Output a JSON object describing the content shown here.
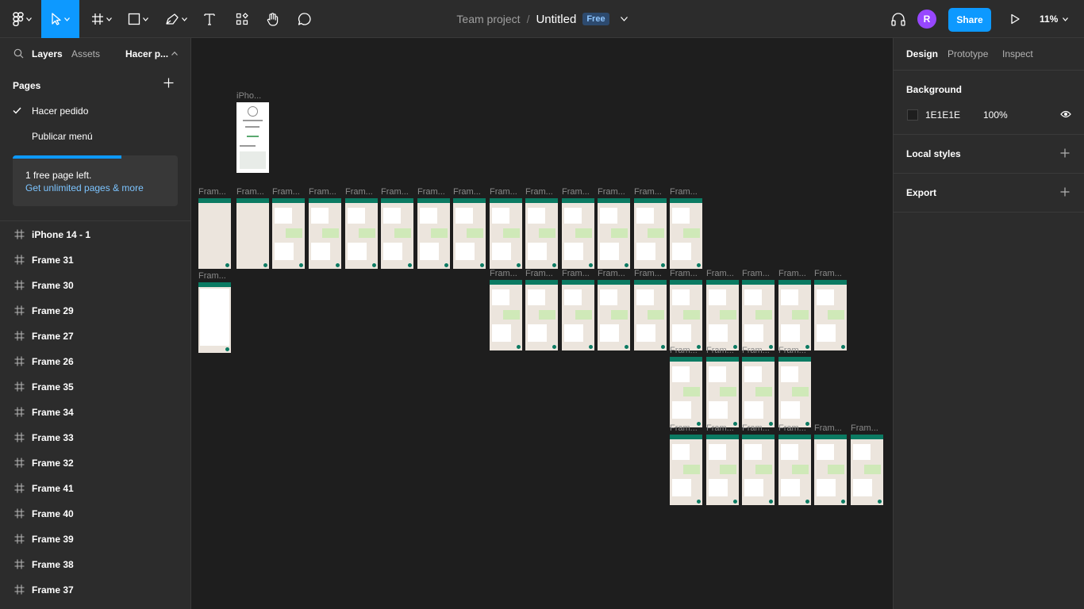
{
  "toolbar": {
    "tools": [
      "main-menu",
      "move-tool",
      "frame-tool",
      "shape-tool",
      "pen-tool",
      "text-tool",
      "resources-tool",
      "hand-tool",
      "comment-tool"
    ],
    "breadcrumb": {
      "project": "Team project",
      "separator": "/",
      "file": "Untitled",
      "badge": "Free"
    },
    "avatar_initial": "R",
    "share_label": "Share",
    "zoom": "11%"
  },
  "left_panel": {
    "tabs": {
      "layers": "Layers",
      "assets": "Assets",
      "page_selector": "Hacer p..."
    },
    "pages_title": "Pages",
    "pages": [
      {
        "label": "Hacer pedido",
        "selected": true
      },
      {
        "label": "Publicar menú",
        "selected": false
      }
    ],
    "upsell": {
      "title": "1 free page left.",
      "link": "Get unlimited pages & more",
      "progress": 0.66
    },
    "layers": [
      "iPhone 14 - 1",
      "Frame 31",
      "Frame 30",
      "Frame 29",
      "Frame 27",
      "Frame 26",
      "Frame 35",
      "Frame 34",
      "Frame 33",
      "Frame 32",
      "Frame 41",
      "Frame 40",
      "Frame 39",
      "Frame 38",
      "Frame 37"
    ]
  },
  "canvas": {
    "background": "#1E1E1E",
    "iphone_label": "iPho...",
    "frame_label": "Fram...",
    "help": "?"
  },
  "right_panel": {
    "tabs": [
      "Design",
      "Prototype",
      "Inspect"
    ],
    "background_title": "Background",
    "background_hex": "1E1E1E",
    "background_opacity": "100%",
    "local_styles": "Local styles",
    "export": "Export"
  },
  "colors": {
    "accent": "#0d99ff",
    "avatar": "#9747ff",
    "badge_bg": "#2d4a6e",
    "frame_header": "#0b7a62"
  }
}
